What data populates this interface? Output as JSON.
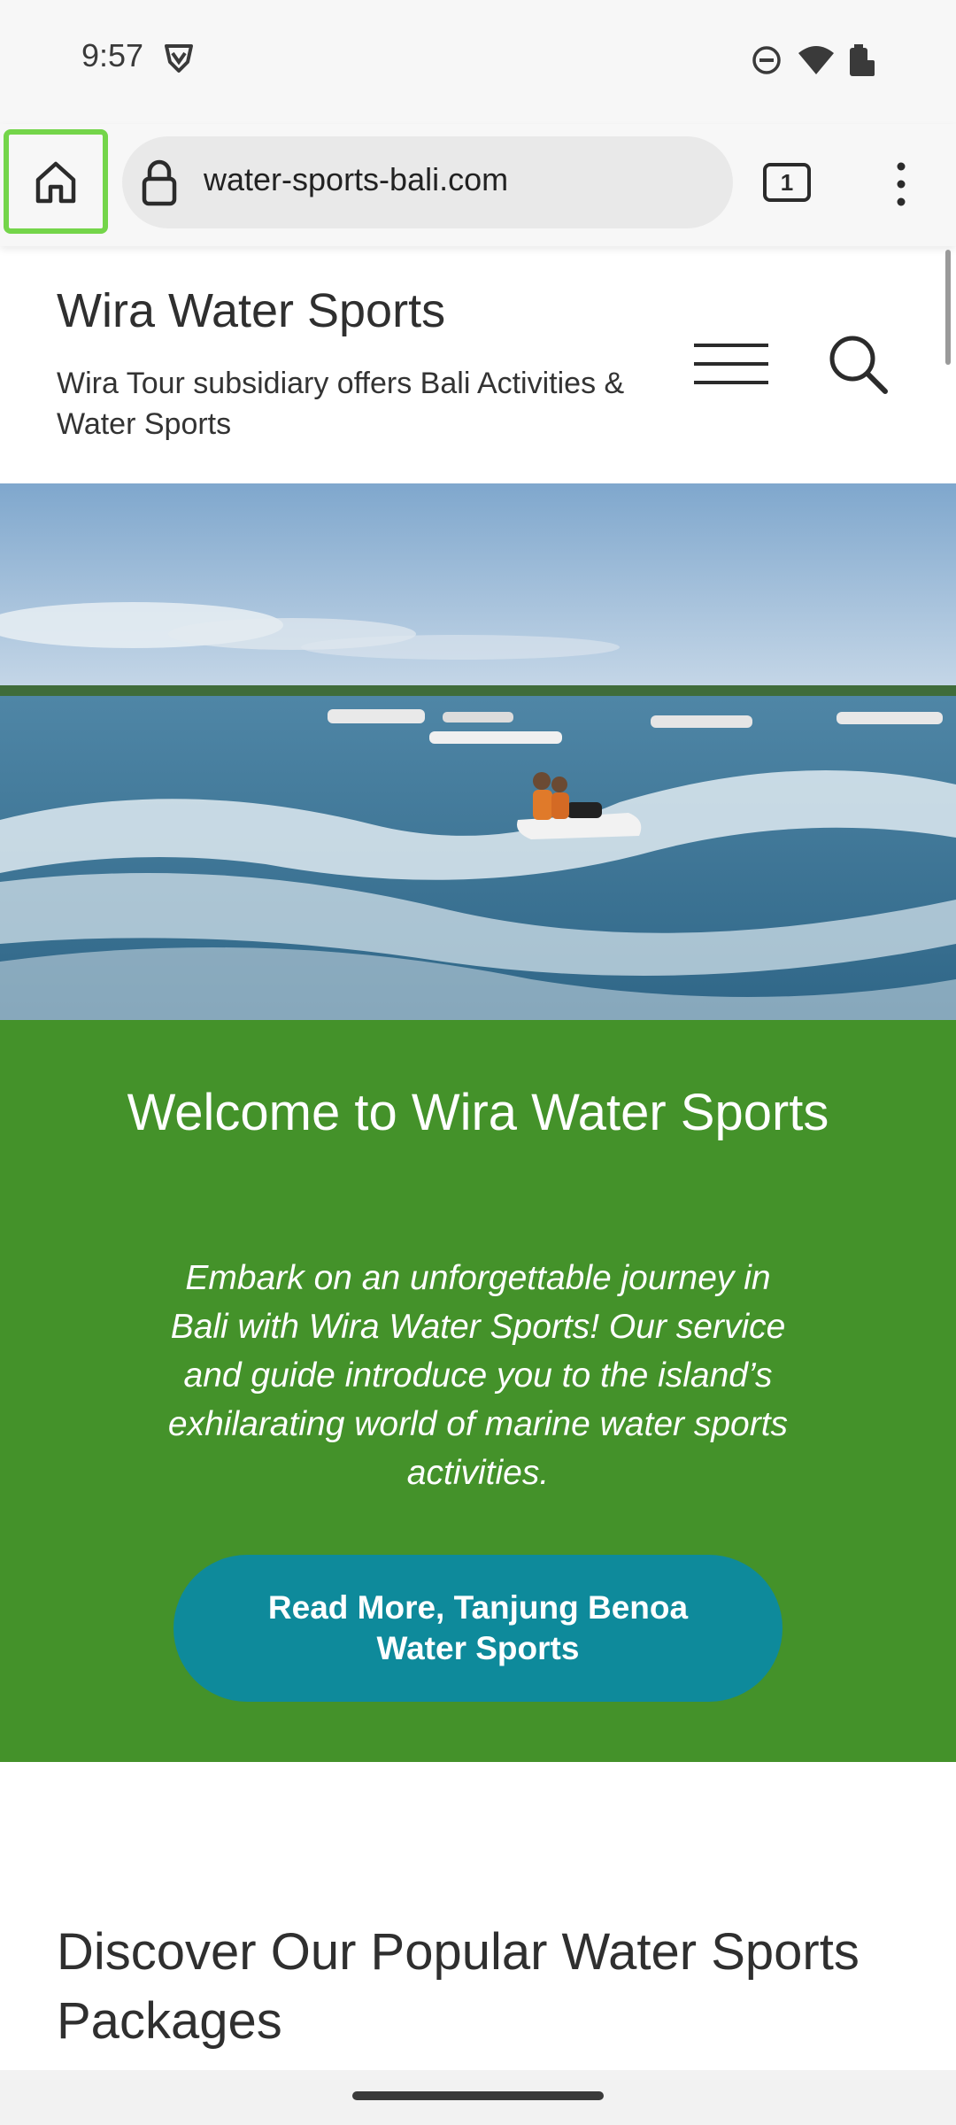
{
  "status_bar": {
    "time": "9:57",
    "icons": [
      "vpn-shield-icon",
      "do-not-disturb-icon",
      "wifi-icon",
      "battery-icon"
    ]
  },
  "browser": {
    "url": "water-sports-bali.com",
    "tab_count": "1",
    "home_highlight_color": "#74d54a"
  },
  "header": {
    "site_title": "Wira Water Sports",
    "tagline": "Wira Tour subsidiary offers Bali Activities & Water Sports"
  },
  "welcome": {
    "title": "Welcome to Wira Water Sports",
    "text": "Embark on an unforgettable journey in Bali with Wira Water Sports! Our service and guide introduce you to the island’s exhilarating world of marine water sports activities.",
    "button_label": "Read More, Tanjung Benoa Water Sports",
    "background_color": "#44922a",
    "button_color": "#0e8a9b"
  },
  "discover": {
    "title": "Discover Our Popular Water Sports Packages"
  }
}
